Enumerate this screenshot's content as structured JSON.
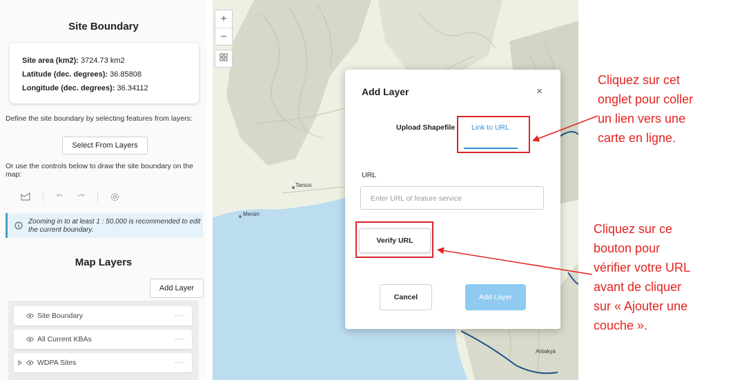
{
  "left_panel": {
    "site_boundary_title": "Site Boundary",
    "site_area_label": "Site area (km2):",
    "site_area_value": "3724.73 km2",
    "latitude_label": "Latitude (dec. degrees):",
    "latitude_value": "36.85808",
    "longitude_label": "Longitude (dec. degrees):",
    "longitude_value": "36.34112",
    "define_text": "Define the site boundary by selecting features from layers:",
    "select_button": "Select From Layers",
    "draw_text": "Or use the controls below to draw the site boundary on the map:",
    "notice_text": "Zooming in to at least 1 : 50,000 is recommended to edit the current boundary.",
    "map_layers_title": "Map Layers",
    "add_layer_button": "Add Layer",
    "layers": [
      {
        "label": "Site Boundary"
      },
      {
        "label": "All Current KBAs"
      },
      {
        "label": "WDPA Sites"
      }
    ],
    "layer_menu": "···"
  },
  "map": {
    "zoom_in": "+",
    "zoom_out": "−",
    "labels": {
      "tarsus": "Tarsus",
      "mersin": "Mersin",
      "antakya": "Antakya"
    },
    "colors": {
      "sea": "#bcdcf0",
      "land": "#eef0e4",
      "boundary": "#1f4f8a"
    }
  },
  "modal": {
    "title": "Add Layer",
    "close": "×",
    "tab_upload": "Upload Shapefile",
    "tab_link": "Link to URL",
    "url_label": "URL",
    "url_placeholder": "Enter URL of feature service",
    "verify_button": "Verify URL",
    "cancel_button": "Cancel",
    "add_button": "Add Layer",
    "colors": {
      "accent": "#2f8fcf",
      "highlight": "#d6262b",
      "add_disabled": "#8fcaf0"
    }
  },
  "annotations": {
    "tab_callout": [
      "Cliquez sur cet",
      "onglet pour coller",
      "un lien vers une",
      "carte en ligne."
    ],
    "verify_callout": [
      "Cliquez sur ce",
      "bouton pour",
      "vérifier votre URL",
      "avant de cliquer",
      "sur « Ajouter une",
      "couche »."
    ]
  }
}
